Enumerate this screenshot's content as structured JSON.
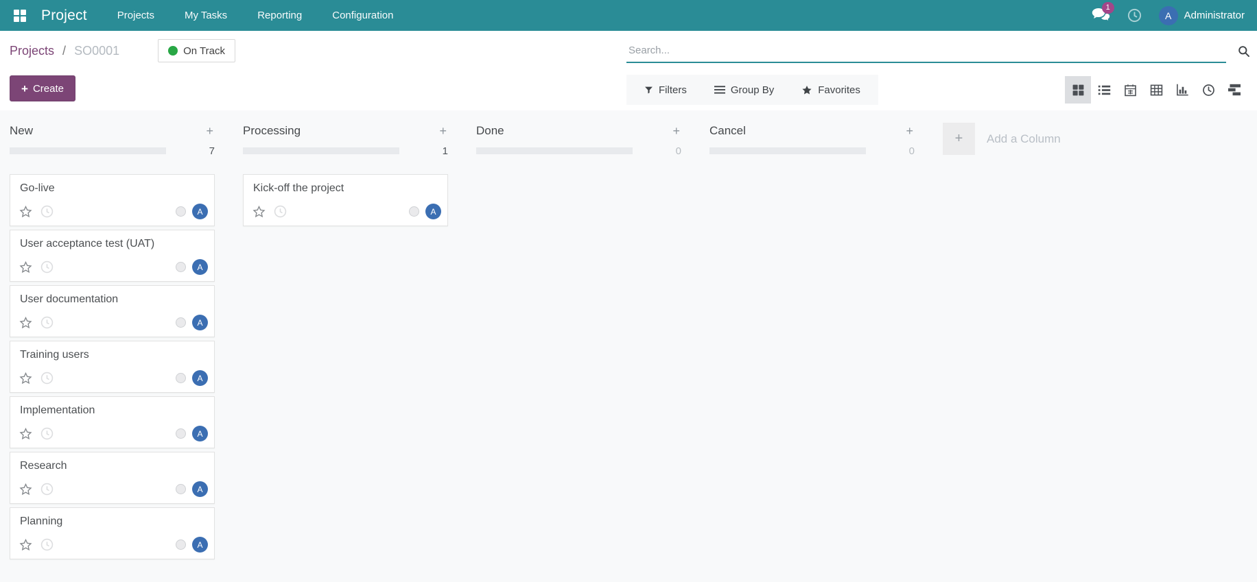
{
  "colors": {
    "navbar_teal": "#2A8C96",
    "primary_purple": "#7C4576",
    "badge_magenta": "#A24689",
    "avatar_blue": "#3B6EB2",
    "status_green": "#28A745"
  },
  "navbar": {
    "app_name": "Project",
    "menu_items": [
      {
        "label": "Projects"
      },
      {
        "label": "My Tasks"
      },
      {
        "label": "Reporting"
      },
      {
        "label": "Configuration"
      }
    ],
    "messages_badge": "1",
    "user_avatar_initial": "A",
    "user_name": "Administrator"
  },
  "control_panel": {
    "breadcrumb": {
      "parent": "Projects",
      "separator": "/",
      "current": "SO0001"
    },
    "status_button": {
      "label": "On Track"
    },
    "create_button": {
      "plus": "+",
      "label": "Create"
    },
    "search": {
      "placeholder": "Search..."
    },
    "search_options": [
      {
        "icon": "filter-funnel-icon",
        "label": "Filters"
      },
      {
        "icon": "group-by-icon",
        "label": "Group By"
      },
      {
        "icon": "favorites-star-icon",
        "label": "Favorites"
      }
    ],
    "view_switcher": [
      {
        "icon": "kanban-view-icon",
        "active": true
      },
      {
        "icon": "list-view-icon",
        "active": false
      },
      {
        "icon": "calendar-view-icon",
        "active": false
      },
      {
        "icon": "pivot-view-icon",
        "active": false
      },
      {
        "icon": "graph-view-icon",
        "active": false
      },
      {
        "icon": "activity-view-icon",
        "active": false
      },
      {
        "icon": "gantt-view-icon",
        "active": false
      }
    ]
  },
  "kanban": {
    "card_avatar_initial": "A",
    "column_plus": "+",
    "add_column": {
      "plus": "+",
      "label": "Add a Column"
    },
    "columns": [
      {
        "name": "New",
        "count": "7",
        "cards": [
          {
            "title": "Go-live"
          },
          {
            "title": "User acceptance test (UAT)"
          },
          {
            "title": "User documentation"
          },
          {
            "title": "Training users"
          },
          {
            "title": "Implementation"
          },
          {
            "title": "Research"
          },
          {
            "title": "Planning"
          }
        ]
      },
      {
        "name": "Processing",
        "count": "1",
        "cards": [
          {
            "title": "Kick-off the project"
          }
        ]
      },
      {
        "name": "Done",
        "count": "0",
        "cards": []
      },
      {
        "name": "Cancel",
        "count": "0",
        "cards": []
      }
    ]
  }
}
